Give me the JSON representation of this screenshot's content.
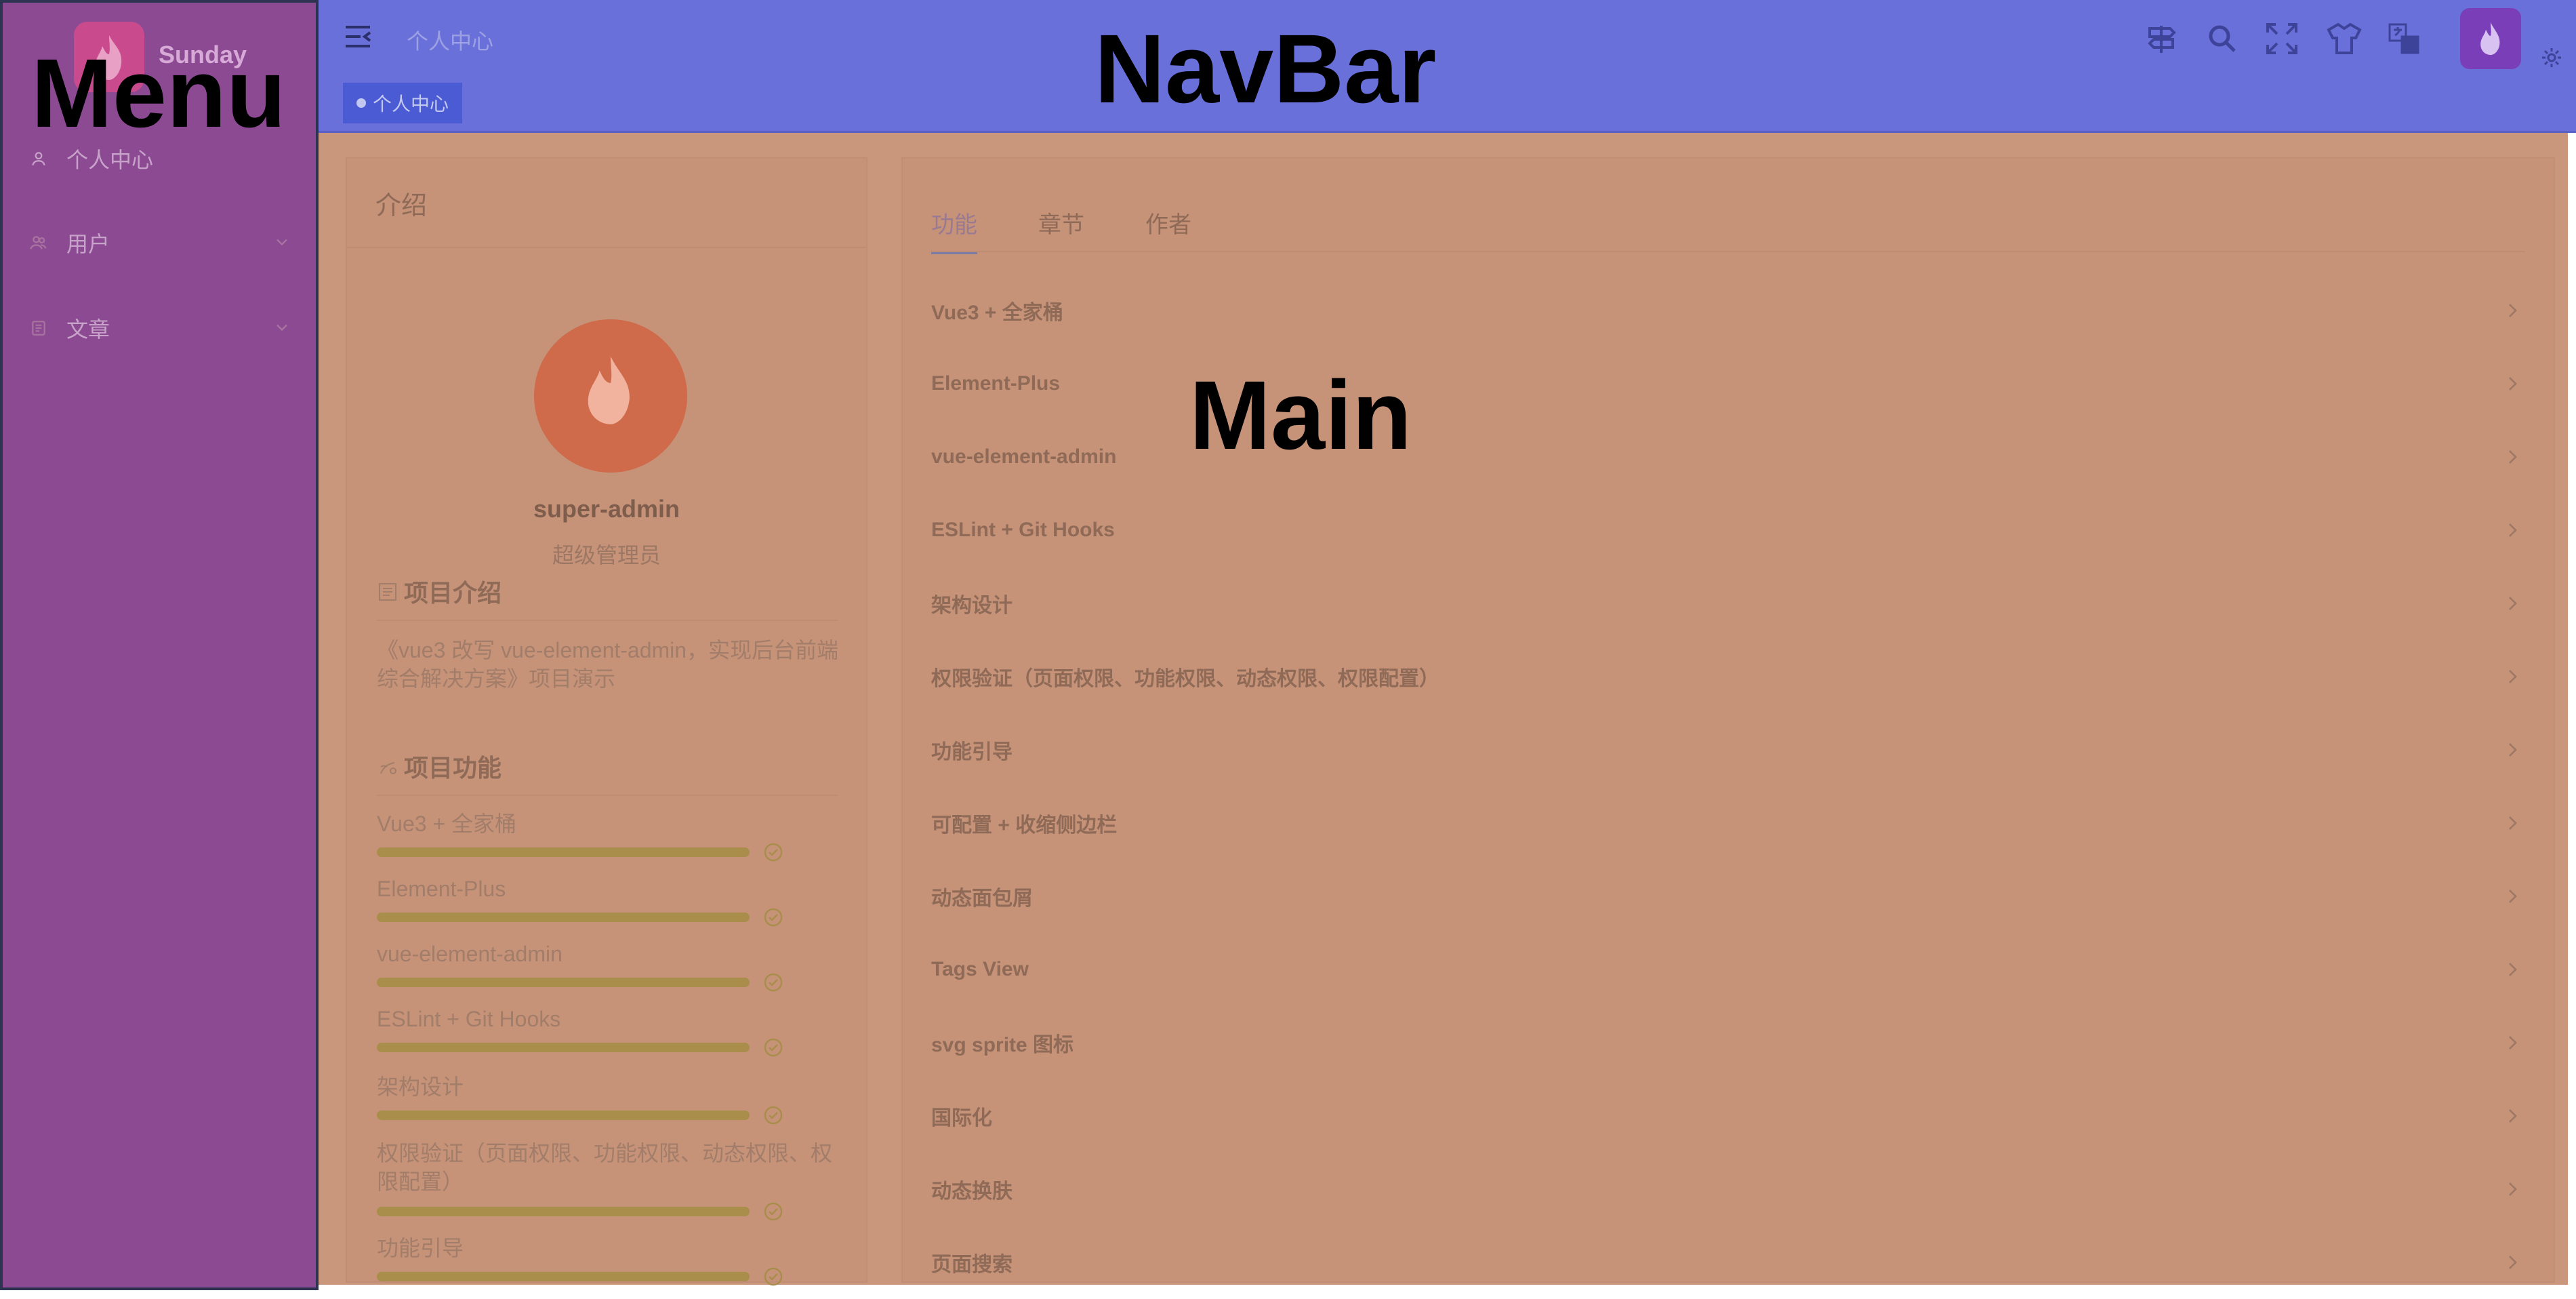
{
  "sidebar": {
    "logo_text": "Sunday",
    "overlay_label": "Menu",
    "items": [
      {
        "label": "个人中心",
        "icon": "user-icon"
      },
      {
        "label": "用户",
        "icon": "users-icon"
      },
      {
        "label": "文章",
        "icon": "article-icon"
      }
    ]
  },
  "navbar": {
    "overlay_label": "NavBar",
    "breadcrumb": "个人中心",
    "tag_label": "个人中心",
    "icons": [
      "guide-icon",
      "search-icon",
      "fullscreen-icon",
      "theme-icon",
      "language-icon",
      "avatar",
      "settings-icon"
    ]
  },
  "main": {
    "overlay_label": "Main",
    "left": {
      "title": "介绍",
      "username": "super-admin",
      "role": "超级管理员",
      "project_intro_title": "项目介绍",
      "project_intro_text": "《vue3 改写 vue-element-admin，实现后台前端综合解决方案》项目演示",
      "features_title": "项目功能",
      "features": [
        {
          "label": "Vue3 + 全家桶",
          "progress": 100
        },
        {
          "label": "Element-Plus",
          "progress": 100
        },
        {
          "label": "vue-element-admin",
          "progress": 100
        },
        {
          "label": "ESLint + Git Hooks",
          "progress": 100
        },
        {
          "label": "架构设计",
          "progress": 100
        },
        {
          "label": "权限验证（页面权限、功能权限、动态权限、权限配置）",
          "progress": 100
        },
        {
          "label": "功能引导",
          "progress": 100
        }
      ]
    },
    "right": {
      "tabs": [
        "功能",
        "章节",
        "作者"
      ],
      "active_tab": "功能",
      "items": [
        "Vue3 + 全家桶",
        "Element-Plus",
        "vue-element-admin",
        "ESLint + Git Hooks",
        "架构设计",
        "权限验证（页面权限、功能权限、动态权限、权限配置）",
        "功能引导",
        "可配置 + 收缩侧边栏",
        "动态面包屑",
        "Tags View",
        "svg sprite 图标",
        "国际化",
        "动态换肤",
        "页面搜索"
      ]
    }
  },
  "colors": {
    "sidebar_bg": "#8c4a93",
    "navbar_bg": "#6a70d9",
    "main_bg": "#c9977b",
    "progress": "#a98d4b",
    "avatar_bg": "#cf6b4b"
  }
}
